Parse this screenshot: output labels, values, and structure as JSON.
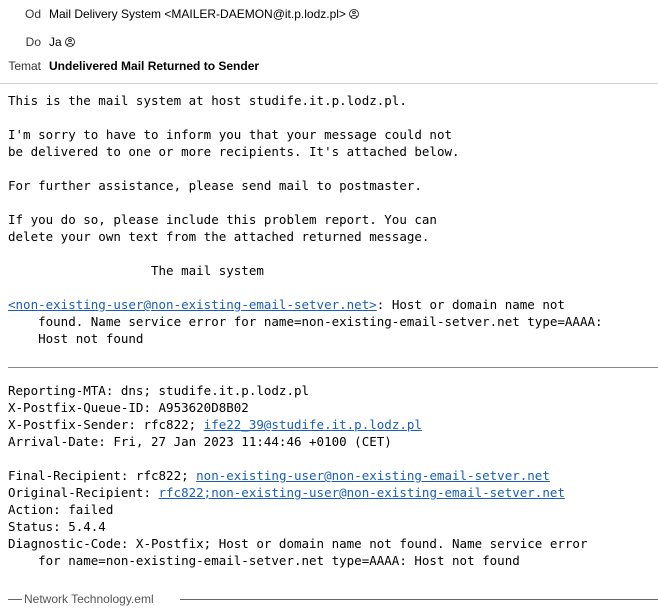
{
  "header": {
    "from_label": "Od",
    "from_value": "Mail Delivery System <MAILER-DAEMON@it.p.lodz.pl>",
    "to_label": "Do",
    "to_value": "Ja",
    "subject_label": "Temat",
    "subject_value": "Undelivered Mail Returned to Sender"
  },
  "body": {
    "l1": "This is the mail system at host studife.it.p.lodz.pl.",
    "l2": "I'm sorry to have to inform you that your message could not",
    "l3": "be delivered to one or more recipients. It's attached below.",
    "l4": "For further assistance, please send mail to postmaster.",
    "l5": "If you do so, please include this problem report. You can",
    "l6": "delete your own text from the attached returned message.",
    "l7": "                   The mail system",
    "err_link": "<non-existing-user@non-existing-email-setver.net>",
    "err_rest": ": Host or domain name not",
    "err_l2": "    found. Name service error for name=non-existing-email-setver.net type=AAAA:",
    "err_l3": "    Host not found"
  },
  "report": {
    "r1": "Reporting-MTA: dns; studife.it.p.lodz.pl",
    "r2": "X-Postfix-Queue-ID: A953620D8B02",
    "r3_prefix": "X-Postfix-Sender: rfc822; ",
    "r3_link": "ife22_39@studife.it.p.lodz.pl",
    "r4": "Arrival-Date: Fri, 27 Jan 2023 11:44:46 +0100 (CET)",
    "r5_prefix": "Final-Recipient: rfc822; ",
    "r5_link": "non-existing-user@non-existing-email-setver.net",
    "r6_prefix": "Original-Recipient: ",
    "r6_link": "rfc822;non-existing-user@non-existing-email-setver.net",
    "r7": "Action: failed",
    "r8": "Status: 5.4.4",
    "r9": "Diagnostic-Code: X-Postfix; Host or domain name not found. Name service error",
    "r10": "    for name=non-existing-email-setver.net type=AAAA: Host not found"
  },
  "attachment": {
    "name": "Network Technology.eml"
  },
  "colors": {
    "link": "#1a5fb4"
  }
}
